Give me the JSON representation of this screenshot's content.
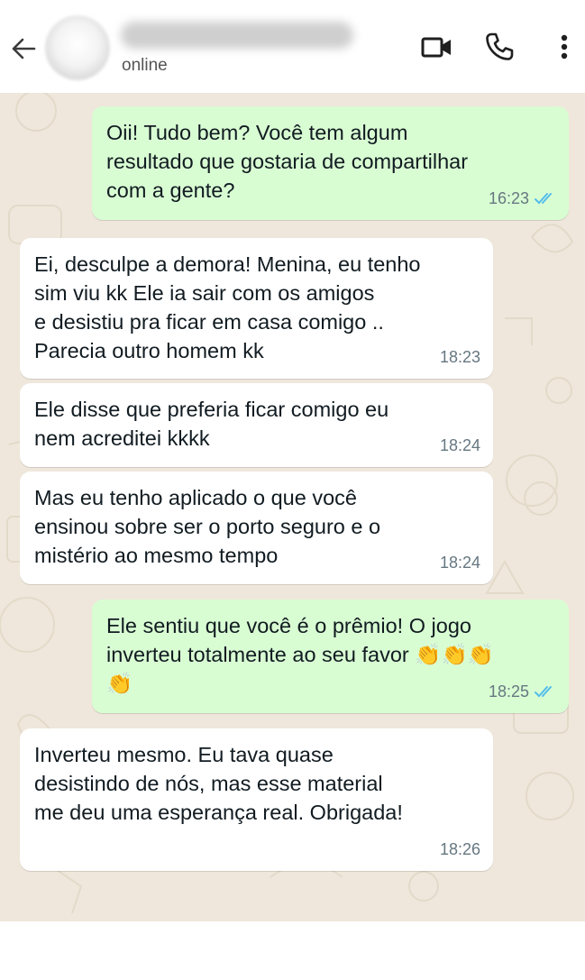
{
  "header": {
    "status": "online",
    "back_icon": "arrow-left-icon",
    "video_icon": "video-camera-icon",
    "call_icon": "phone-icon",
    "menu_icon": "more-vert-icon"
  },
  "colors": {
    "outgoing_bubble": "#d9fdd3",
    "incoming_bubble": "#ffffff",
    "chat_background": "#efe7db",
    "read_ticks": "#53bdeb"
  },
  "messages": [
    {
      "direction": "out",
      "lines": [
        "Oii! Tudo bem? Você tem algum",
        "resultado que gostaria de compartilhar",
        "com a gente?"
      ],
      "time": "16:23",
      "status": "read"
    },
    {
      "direction": "in",
      "lines": [
        "Ei, desculpe a demora! Menina, eu tenho",
        "sim viu kk Ele ia sair com os amigos",
        "e desistiu pra ficar em casa comigo ..",
        "Parecia outro homem kk"
      ],
      "time": "18:23"
    },
    {
      "direction": "in",
      "lines": [
        "Ele disse que preferia ficar comigo eu",
        "nem acreditei kkkk"
      ],
      "time": "18:24"
    },
    {
      "direction": "in",
      "lines": [
        "Mas eu tenho aplicado o que você",
        "ensinou sobre ser o porto seguro e o",
        "mistério ao mesmo tempo"
      ],
      "time": "18:24"
    },
    {
      "direction": "out",
      "lines": [
        "Ele sentiu que você é o prêmio! O jogo",
        "inverteu totalmente ao seu favor 👏👏👏",
        "👏"
      ],
      "time": "18:25",
      "status": "read"
    },
    {
      "direction": "in",
      "lines": [
        "Inverteu mesmo. Eu tava quase",
        "desistindo de nós, mas esse material",
        "me deu uma esperança real. Obrigada!"
      ],
      "time": "18:26"
    }
  ]
}
